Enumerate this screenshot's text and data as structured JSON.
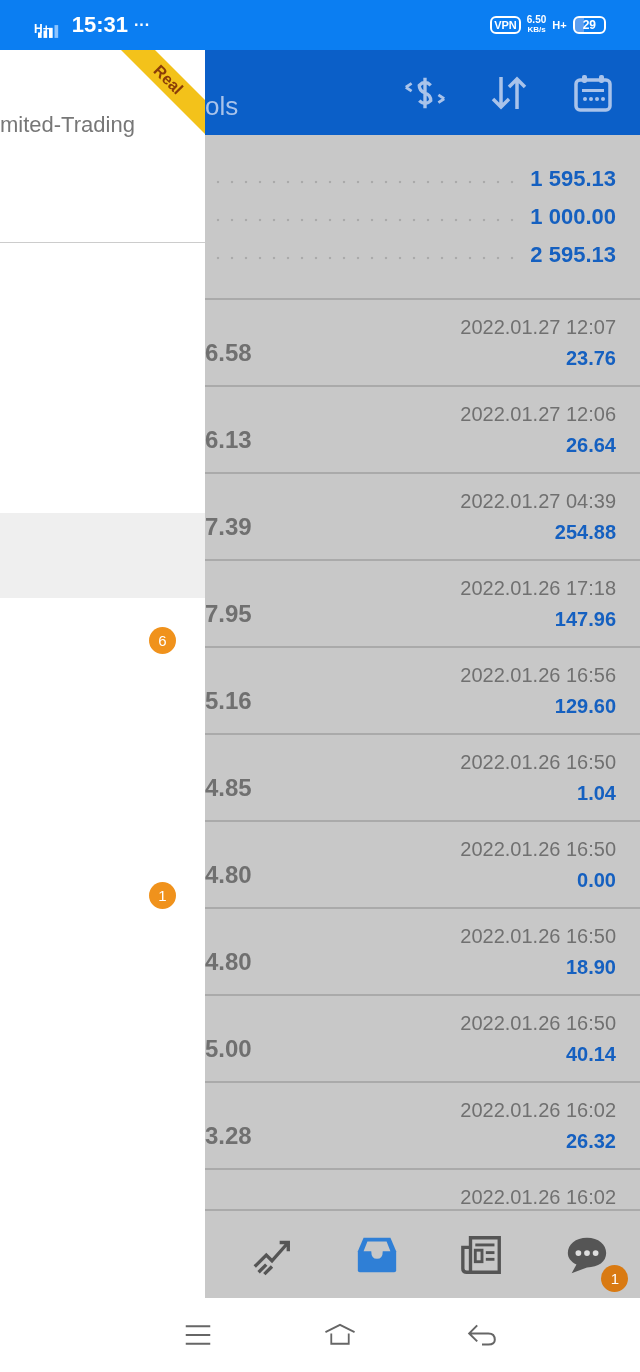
{
  "status_bar": {
    "network": "H+",
    "time": "15:31",
    "more": "···",
    "vpn": "VPN",
    "speed": "6.50",
    "speed_unit": "KB/s",
    "network_right": "H+",
    "battery": "29"
  },
  "drawer": {
    "ribbon": "Real",
    "account": "mited-Trading",
    "items": [
      {
        "selected": true
      },
      {
        "selected": false,
        "badge": "6"
      },
      {
        "selected": false,
        "badge": "1"
      }
    ]
  },
  "header": {
    "title": "ols"
  },
  "summary": [
    "1 595.13",
    "1 000.00",
    "2 595.13"
  ],
  "deals": [
    {
      "price": "6.58",
      "time": "2022.01.27 12:07",
      "profit": "23.76"
    },
    {
      "price": "6.13",
      "time": "2022.01.27 12:06",
      "profit": "26.64"
    },
    {
      "price": "7.39",
      "time": "2022.01.27 04:39",
      "profit": "254.88"
    },
    {
      "price": "7.95",
      "time": "2022.01.26 17:18",
      "profit": "147.96"
    },
    {
      "price": "5.16",
      "time": "2022.01.26 16:56",
      "profit": "129.60"
    },
    {
      "price": "4.85",
      "time": "2022.01.26 16:50",
      "profit": "1.04"
    },
    {
      "price": "4.80",
      "time": "2022.01.26 16:50",
      "profit": "0.00"
    },
    {
      "price": "4.80",
      "time": "2022.01.26 16:50",
      "profit": "18.90"
    },
    {
      "price": "5.00",
      "time": "2022.01.26 16:50",
      "profit": "40.14"
    },
    {
      "price": "3.28",
      "time": "2022.01.26 16:02",
      "profit": "26.32"
    },
    {
      "time": "2022.01.26 16:02"
    }
  ],
  "tabs": [
    {
      "kind": "chart",
      "selected": false
    },
    {
      "kind": "inbox",
      "selected": true
    },
    {
      "kind": "news",
      "selected": false
    },
    {
      "kind": "chat",
      "selected": false,
      "badge": "1"
    }
  ]
}
